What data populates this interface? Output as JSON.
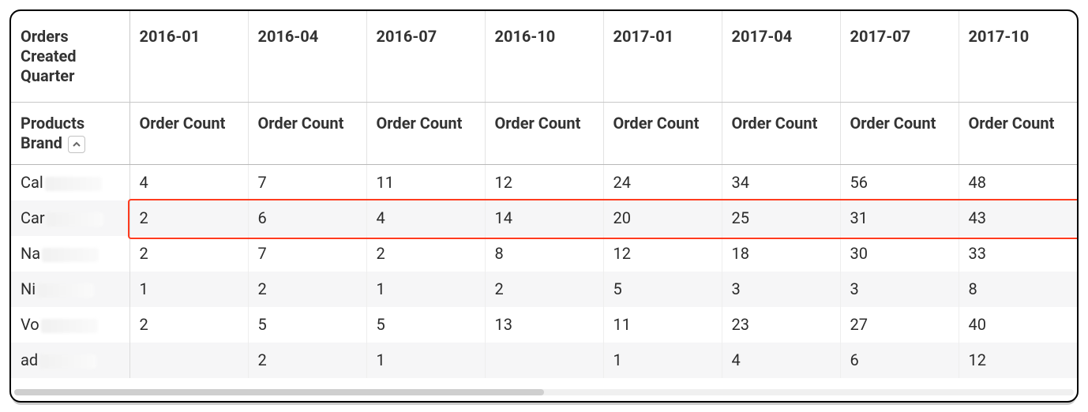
{
  "chart_data": {
    "type": "table",
    "title": "",
    "row_dimension": "Products Brand",
    "column_dimension": "Orders Created Quarter",
    "measure": "Order Count",
    "categories": [
      "2016-01",
      "2016-04",
      "2016-07",
      "2016-10",
      "2017-01",
      "2017-04",
      "2017-07",
      "2017-10"
    ],
    "series": [
      {
        "name": "Cal",
        "values": [
          4,
          7,
          11,
          12,
          24,
          34,
          56,
          48
        ]
      },
      {
        "name": "Car",
        "values": [
          2,
          6,
          4,
          14,
          20,
          25,
          31,
          43
        ]
      },
      {
        "name": "Na",
        "values": [
          2,
          7,
          2,
          8,
          12,
          18,
          30,
          33
        ]
      },
      {
        "name": "Ni",
        "values": [
          1,
          2,
          1,
          2,
          5,
          3,
          3,
          8
        ]
      },
      {
        "name": "Vo",
        "values": [
          2,
          5,
          5,
          13,
          11,
          23,
          27,
          40
        ]
      },
      {
        "name": "ad",
        "values": [
          null,
          2,
          1,
          null,
          1,
          4,
          6,
          12
        ]
      }
    ],
    "highlighted_row_index": 1,
    "sort": {
      "field": "Products Brand",
      "direction": "asc"
    }
  },
  "header": {
    "pivot_label": "Orders Created Quarter",
    "row_label": "Products Brand",
    "measure_label": "Order Count",
    "quarters": [
      "2016-01",
      "2016-04",
      "2016-07",
      "2016-10",
      "2017-01",
      "2017-04",
      "2017-07",
      "2017-10"
    ]
  },
  "rows": [
    {
      "brand_visible": "Cal",
      "cells": [
        "4",
        "7",
        "11",
        "12",
        "24",
        "34",
        "56",
        "48"
      ]
    },
    {
      "brand_visible": "Car",
      "cells": [
        "2",
        "6",
        "4",
        "14",
        "20",
        "25",
        "31",
        "43"
      ]
    },
    {
      "brand_visible": "Na",
      "cells": [
        "2",
        "7",
        "2",
        "8",
        "12",
        "18",
        "30",
        "33"
      ]
    },
    {
      "brand_visible": "Ni",
      "cells": [
        "1",
        "2",
        "1",
        "2",
        "5",
        "3",
        "3",
        "8"
      ]
    },
    {
      "brand_visible": "Vo",
      "cells": [
        "2",
        "5",
        "5",
        "13",
        "11",
        "23",
        "27",
        "40"
      ]
    },
    {
      "brand_visible": "ad",
      "cells": [
        "",
        "2",
        "1",
        "",
        "1",
        "4",
        "6",
        "12"
      ]
    }
  ],
  "highlight_row": 1
}
